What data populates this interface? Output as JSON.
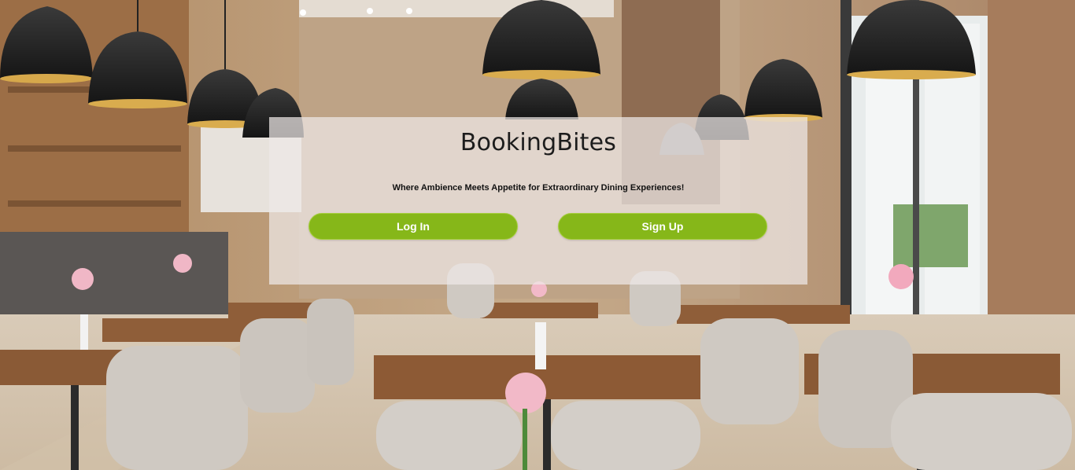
{
  "app": {
    "title": "BookingBites",
    "tagline": "Where Ambience Meets Appetite for Extraordinary Dining Experiences!"
  },
  "actions": {
    "login_label": "Log In",
    "signup_label": "Sign Up"
  },
  "colors": {
    "button_bg": "#86b719",
    "button_text": "#ffffff",
    "card_bg": "rgba(238,233,231,0.72)"
  },
  "background": {
    "icon": "restaurant-interior-photo"
  }
}
